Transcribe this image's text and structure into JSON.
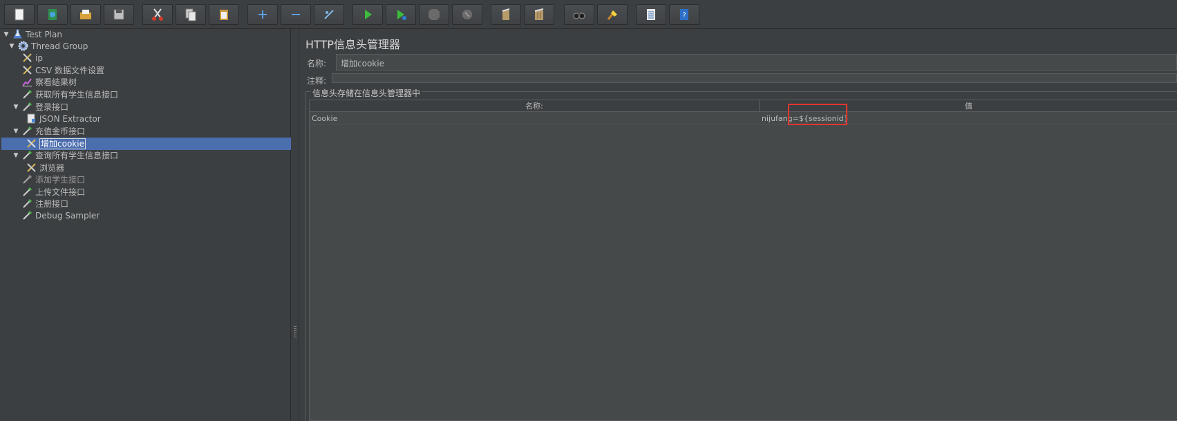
{
  "toolbar": {
    "buttons": [
      {
        "name": "new-icon"
      },
      {
        "name": "templates-icon"
      },
      {
        "name": "open-icon"
      },
      {
        "name": "save-icon"
      },
      {
        "name": "cut-icon"
      },
      {
        "name": "copy-icon"
      },
      {
        "name": "paste-icon"
      },
      {
        "name": "expand-icon"
      },
      {
        "name": "collapse-icon"
      },
      {
        "name": "toggle-icon"
      },
      {
        "name": "start-icon"
      },
      {
        "name": "start-no-pause-icon"
      },
      {
        "name": "stop-icon"
      },
      {
        "name": "shutdown-icon"
      },
      {
        "name": "clear-icon"
      },
      {
        "name": "clear-all-icon"
      },
      {
        "name": "search-icon"
      },
      {
        "name": "reset-search-icon"
      },
      {
        "name": "function-helper-icon"
      },
      {
        "name": "help-icon"
      }
    ]
  },
  "tree": {
    "items": [
      {
        "label": "Test Plan",
        "icon": "flask-icon"
      },
      {
        "label": "Thread Group",
        "icon": "gear-icon"
      },
      {
        "label": "ip",
        "icon": "tools-icon"
      },
      {
        "label": "CSV 数据文件设置",
        "icon": "tools-icon"
      },
      {
        "label": "察看结果树",
        "icon": "chart-icon"
      },
      {
        "label": "获取所有学生信息接口",
        "icon": "pipette-icon"
      },
      {
        "label": "登录接口",
        "icon": "pipette-icon"
      },
      {
        "label": "JSON Extractor",
        "icon": "document-icon"
      },
      {
        "label": "充值金币接口",
        "icon": "pipette-icon"
      },
      {
        "label": "增加cookie",
        "icon": "tools-icon"
      },
      {
        "label": "查询所有学生信息接口",
        "icon": "pipette-icon"
      },
      {
        "label": "浏览器",
        "icon": "tools-icon"
      },
      {
        "label": "添加学生接口",
        "icon": "pipette-icon"
      },
      {
        "label": "上传文件接口",
        "icon": "pipette-icon"
      },
      {
        "label": "注册接口",
        "icon": "pipette-icon"
      },
      {
        "label": "Debug Sampler",
        "icon": "pipette-icon"
      }
    ]
  },
  "panel": {
    "title": "HTTP信息头管理器",
    "name_label": "名称:",
    "name_value": "增加cookie",
    "comment_label": "注释:",
    "comment_value": "",
    "group_title": "信息头存储在信息头管理器中",
    "table": {
      "headers": [
        "名称:",
        "值"
      ],
      "rows": [
        {
          "name": "Cookie",
          "value": "nijufang=${sessionid}"
        }
      ]
    }
  },
  "colors": {
    "background": "#3c3f41",
    "selection": "#4b6eaf",
    "highlight_box": "#e0372f"
  }
}
